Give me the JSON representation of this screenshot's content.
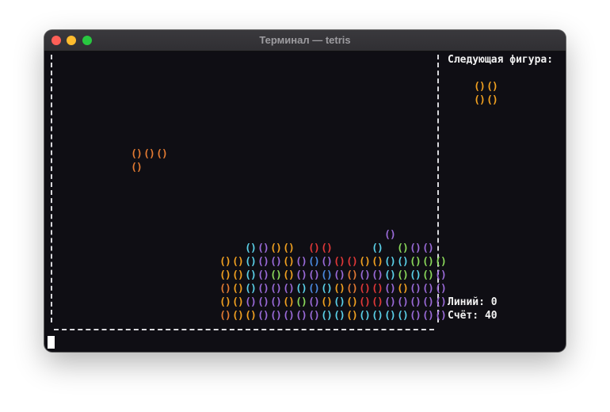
{
  "window": {
    "title": "Терминал — tetris",
    "lights": [
      "#fe5f57",
      "#febc2e",
      "#28c840"
    ]
  },
  "game": {
    "next_label": "Следующая фигура:",
    "lines_label": "Линий: 0",
    "score_label": "Счёт: 40",
    "block_glyph": "()",
    "colors": {
      "O": "#f0a020",
      "R": "#e27a32",
      "C": "#5ad0e8",
      "P": "#9a6ad8",
      "G": "#8ad85a",
      "B": "#4a8ae0",
      "D": "#e03838"
    },
    "next_piece": [
      "OO",
      "OO"
    ],
    "falling_piece": {
      "color": "R",
      "rows": [
        "RRR",
        "R.."
      ]
    },
    "board_rows": [
      "...............P",
      "....CPOO.DD...C.GPP",
      "..OOCPPOPBPDDOOCCGGG",
      "..OOCPGOPPBPRPPCGCGP",
      "..ROCPPPCBCORDDPOPPP",
      "..OOPPPOGPOCODDPPPPP",
      "..ROOPPPPPCCOCCCCPPP"
    ]
  }
}
